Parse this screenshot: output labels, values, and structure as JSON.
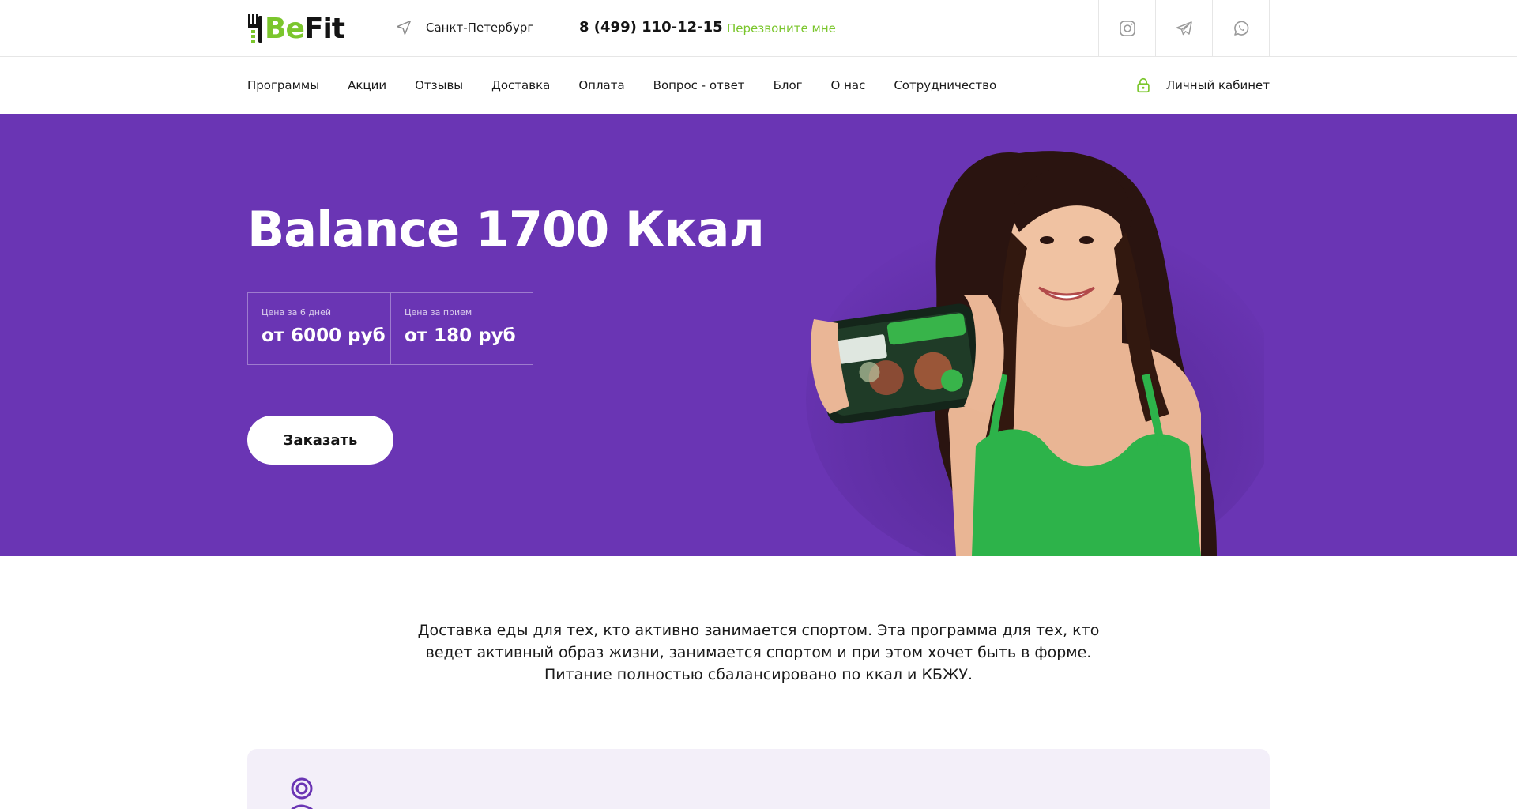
{
  "brand": {
    "name_part1": "Be",
    "name_part2": "Fit",
    "accent_color": "#7bc62d",
    "hero_color": "#6a35b4"
  },
  "header": {
    "city_icon": "location-arrow-icon",
    "city": "Санкт-Петербург",
    "phone": "8 (499) 110-12-15",
    "callback": "Перезвоните мне",
    "socials": [
      "instagram-icon",
      "telegram-icon",
      "whatsapp-icon"
    ]
  },
  "nav": {
    "items": [
      "Программы",
      "Акции",
      "Отзывы",
      "Доставка",
      "Оплата",
      "Вопрос - ответ",
      "Блог",
      "О нас",
      "Сотрудничество"
    ],
    "cabinet_icon": "lock-icon",
    "cabinet_label": "Личный кабинет"
  },
  "hero": {
    "title": "Balance 1700 Ккал",
    "prices": [
      {
        "caption": "Цена за 6 дней",
        "value": "от 6000 руб"
      },
      {
        "caption": "Цена за прием",
        "value": "от 180 руб"
      }
    ],
    "order_label": "Заказать"
  },
  "description": {
    "lines": [
      "Доставка еды для тех, кто активно занимается спортом. Эта программа для тех, кто",
      "ведет активный образ жизни, занимается спортом и при этом хочет быть в форме.",
      "Питание полностью сбалансировано по ккал и КБЖУ."
    ]
  }
}
